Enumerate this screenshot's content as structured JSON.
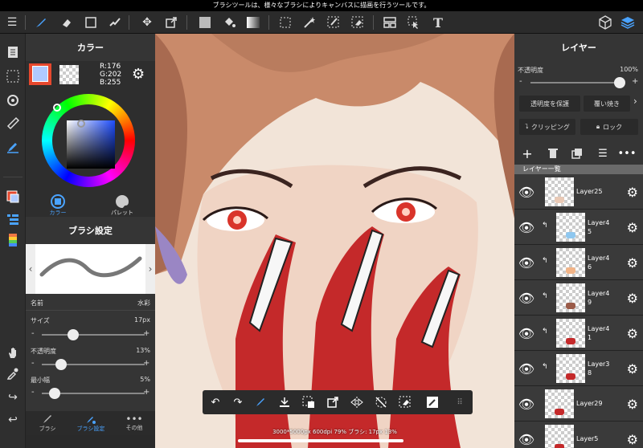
{
  "topbar": {
    "message": "ブラシツールは、様々なブラシによりキャンバスに描画を行うツールです。"
  },
  "toolbar": {
    "menu_icon": "hamburger-icon",
    "tools": [
      "brush-icon",
      "eraser-icon",
      "rect-icon",
      "pen-icon",
      "move-icon",
      "transform-icon",
      "fill-color-icon",
      "bucket-icon",
      "gradient-icon",
      "select-rect-icon",
      "magic-wand-icon",
      "select-pen-icon",
      "select-eraser-icon",
      "layout-icon",
      "operate-icon",
      "text-icon"
    ],
    "text_tool_label": "T"
  },
  "color_panel": {
    "title": "カラー",
    "r": "R:176",
    "g": "G:202",
    "b": "B:255",
    "main_color": "#b0caff",
    "tabs": [
      {
        "label": "カラー"
      },
      {
        "label": "パレット"
      }
    ]
  },
  "brush_settings": {
    "title": "ブラシ設定",
    "name_label": "名前",
    "name_value": "水彩",
    "size_label": "サイズ",
    "size_value": "17px",
    "size_level": 0.28,
    "opacity_label": "不透明度",
    "opacity_value": "13%",
    "opacity_level": 0.15,
    "minwidth_label": "最小幅",
    "minwidth_value": "5%",
    "minwidth_level": 0.08,
    "bottom_tabs": [
      {
        "label": "ブラシ"
      },
      {
        "label": "ブラシ設定"
      },
      {
        "label": "その他"
      }
    ]
  },
  "layers_panel": {
    "title": "レイヤー",
    "opacity_label": "不透明度",
    "opacity_value": "100%",
    "protect_label": "透明度を保護",
    "overlay_label": "覆い焼き",
    "clipping_label": "クリッピング",
    "lock_label": "ロック",
    "list_title": "レイヤー一覧",
    "layers": [
      {
        "name": "Layer25",
        "clip": false
      },
      {
        "name": "Layer4\n5",
        "clip": true
      },
      {
        "name": "Layer4\n6",
        "clip": true
      },
      {
        "name": "Layer4\n9",
        "clip": true
      },
      {
        "name": "Layer4\n1",
        "clip": true
      },
      {
        "name": "Layer3\n8",
        "clip": true
      },
      {
        "name": "Layer29",
        "clip": false
      },
      {
        "name": "Layer5",
        "clip": false
      }
    ]
  },
  "status": {
    "text": "3000*5000px 600dpi 79% ブラシ: 17px 13%"
  },
  "colors": {
    "accent": "#3d8bff",
    "panel": "#353535",
    "selected_layer": "#6e7ea8"
  }
}
